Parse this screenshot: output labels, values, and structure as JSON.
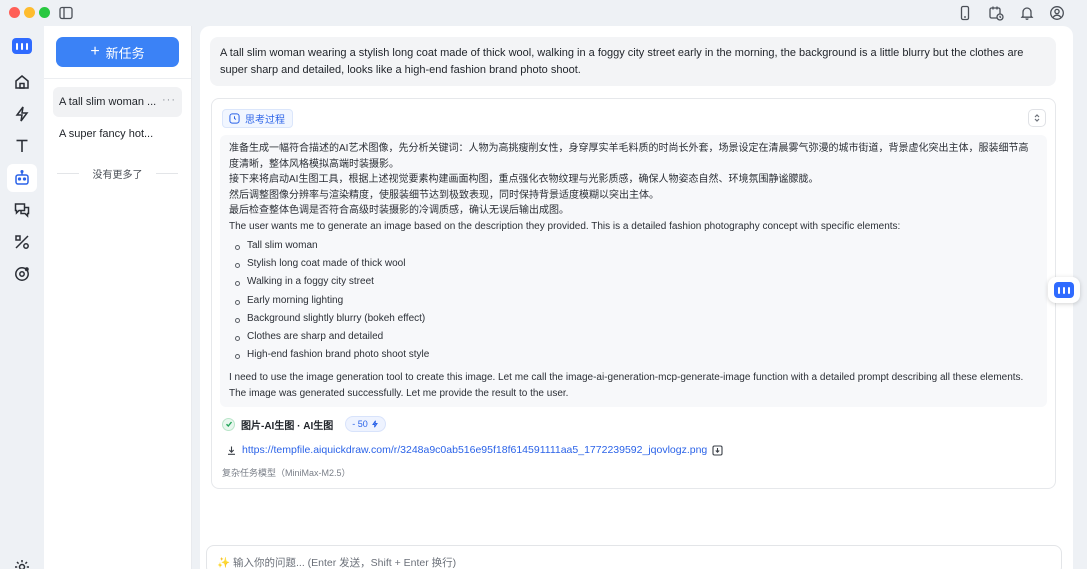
{
  "sidebar": {
    "new_task_label": "新任务",
    "tasks": [
      {
        "title": "A tall slim woman ...",
        "more": "···"
      },
      {
        "title": "A super fancy hot..."
      }
    ],
    "no_more_label": "没有更多了"
  },
  "conversation": {
    "user_message": "A tall slim woman wearing a stylish long coat made of thick wool, walking in a foggy city street early in the morning, the background is a little blurry but the clothes are super sharp and detailed, looks like a high-end fashion brand photo shoot.",
    "thinking_label": "思考过程",
    "thinking_paragraphs": [
      "准备生成一幅符合描述的AI艺术图像，先分析关键词：人物为高挑瘦削女性，身穿厚实羊毛料质的时尚长外套，场景设定在清晨雾气弥漫的城市街道，背景虚化突出主体，服装细节高度清晰，整体风格模拟高端时装摄影。",
      "接下来将启动AI生图工具，根据上述视觉要素构建画面构图，重点强化衣物纹理与光影质感，确保人物姿态自然、环境氛围静谧朦胧。",
      "然后调整图像分辨率与渲染精度，使服装细节达到极致表现，同时保持背景适度模糊以突出主体。",
      "最后检查整体色调是否符合高级时装摄影的冷调质感，确认无误后输出成图。",
      "The user wants me to generate an image based on the description they provided. This is a detailed fashion photography concept with specific elements:"
    ],
    "thinking_list": [
      "Tall slim woman",
      "Stylish long coat made of thick wool",
      "Walking in a foggy city street",
      "Early morning lighting",
      "Background slightly blurry (bokeh effect)",
      "Clothes are sharp and detailed",
      "High-end fashion brand photo shoot style"
    ],
    "thinking_tail": [
      "I need to use the image generation tool to create this image. Let me call the image-ai-generation-mcp-generate-image function with a detailed prompt describing all these elements.",
      "The image was generated successfully. Let me provide the result to the user."
    ],
    "tool_label": "图片-AI生图 · AI生图",
    "cost": "- 50",
    "result_url": "https://tempfile.aiquickdraw.com/r/3248a9c0ab516e95f18f614591111aa5_1772239592_jqovlogz.png",
    "model_note": "复杂任务模型（MiniMax-M2.5）"
  },
  "input": {
    "placeholder": "✨ 输入你的问题... (Enter 发送，Shift + Enter 换行)"
  },
  "colors": {
    "accent": "#3b82f6",
    "link": "#2b63e8"
  },
  "icons": [
    "sidebar-toggle-icon",
    "phone-icon",
    "calendar-icon",
    "bell-icon",
    "user-icon",
    "home-icon",
    "lightning-icon",
    "text-icon",
    "robot-icon",
    "chat-icon",
    "tools-icon",
    "settings-icon"
  ]
}
